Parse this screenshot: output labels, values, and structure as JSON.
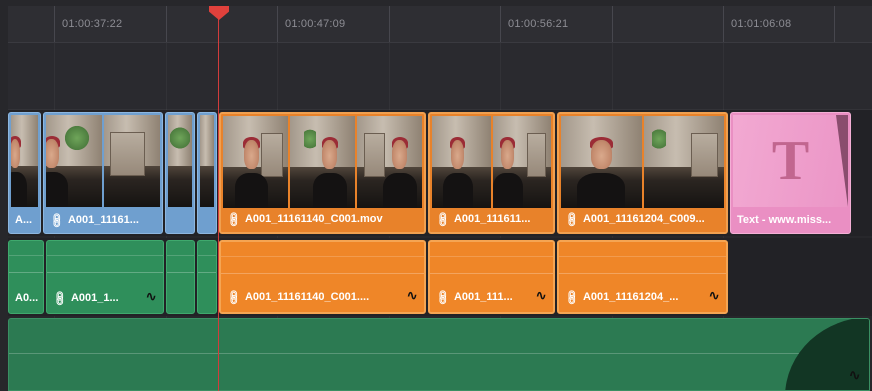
{
  "ruler": {
    "timecodes": [
      "01:00:37:22",
      "01:00:47:09",
      "01:00:56:21",
      "01:01:06:08"
    ]
  },
  "video_track": {
    "clips": [
      {
        "label": "A...",
        "color": "blue",
        "linked": false
      },
      {
        "label": "A001_11161...",
        "color": "blue",
        "linked": true
      },
      {
        "label": "",
        "color": "blue",
        "linked": false
      },
      {
        "label": "",
        "color": "blue",
        "linked": false
      },
      {
        "label": "A001_11161140_C001.mov",
        "color": "orange",
        "linked": true
      },
      {
        "label": "A001_111611...",
        "color": "orange",
        "linked": true
      },
      {
        "label": "A001_11161204_C009...",
        "color": "orange",
        "linked": true
      },
      {
        "label": "Text - www.miss...",
        "color": "pink",
        "linked": false
      }
    ],
    "title_glyph": "T"
  },
  "audio_track": {
    "clips": [
      {
        "label": "A0...",
        "color": "green",
        "linked": false
      },
      {
        "label": "A001_1...",
        "color": "green",
        "linked": true
      },
      {
        "label": "",
        "color": "green",
        "linked": false
      },
      {
        "label": "",
        "color": "green",
        "linked": false
      },
      {
        "label": "A001_11161140_C001....",
        "color": "orange",
        "linked": true
      },
      {
        "label": "A001_111...",
        "color": "orange",
        "linked": true
      },
      {
        "label": "A001_11161204_...",
        "color": "orange",
        "linked": true
      }
    ]
  },
  "icons": {
    "link": "link-icon",
    "audio_fx": "audio-curve-icon",
    "playhead": "playhead-icon"
  },
  "colors": {
    "video_clip_blue": "#6f9fcf",
    "selected_clip_orange": "#e8822a",
    "title_clip_pink": "#ea8fc3",
    "audio_clip_green": "#2f8f5b",
    "playhead_red": "#e0413c"
  }
}
